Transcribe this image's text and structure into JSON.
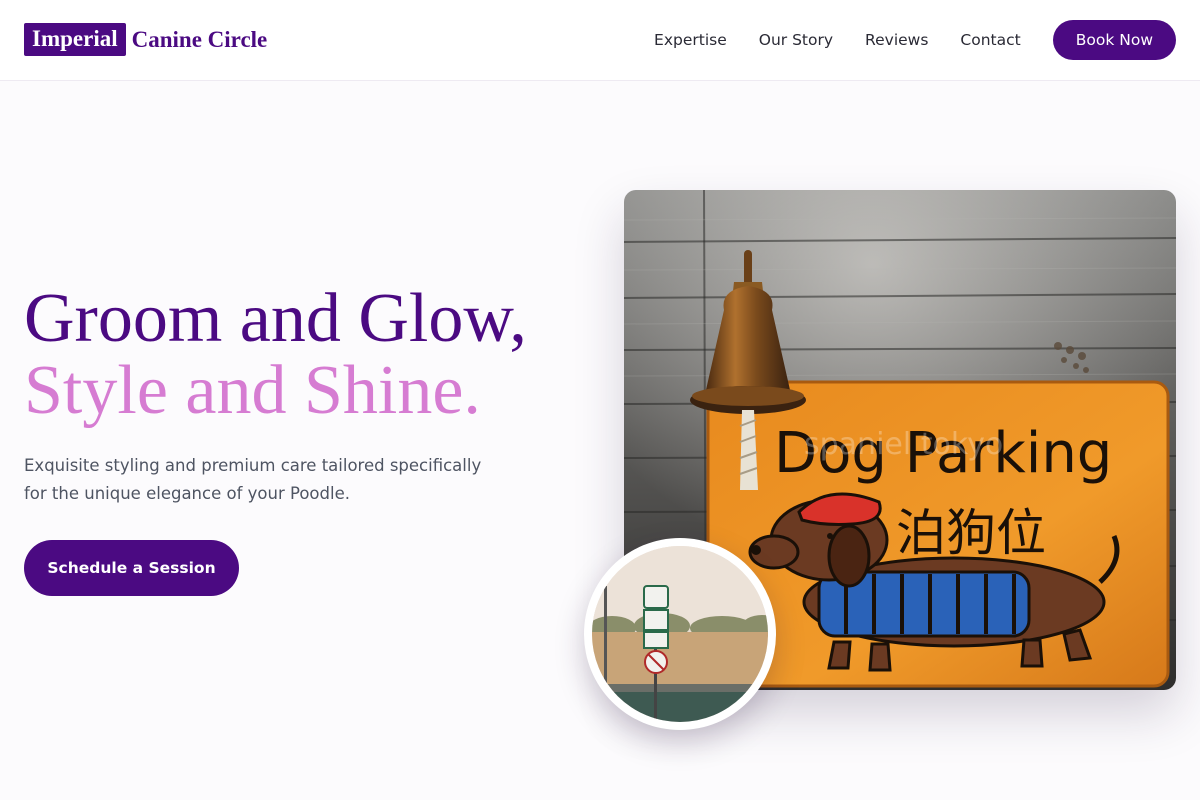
{
  "brand": {
    "box_text": "Imperial",
    "name_text": "Canine Circle",
    "accent_color": "#4b0a82",
    "highlight_color": "#d67cd2"
  },
  "nav": {
    "links": [
      "Expertise",
      "Our Story",
      "Reviews",
      "Contact"
    ],
    "cta_label": "Book Now"
  },
  "hero": {
    "title_line1": "Groom and Glow,",
    "title_line2": "Style and Shine.",
    "subtitle": "Exquisite styling and premium care tailored specifically for the unique elegance of your Poodle.",
    "cta_label": "Schedule a Session"
  },
  "main_image": {
    "sign_text_en": "Dog Parking",
    "sign_text_zh": "泊狗位",
    "watermark": "spaniel tokyo"
  }
}
